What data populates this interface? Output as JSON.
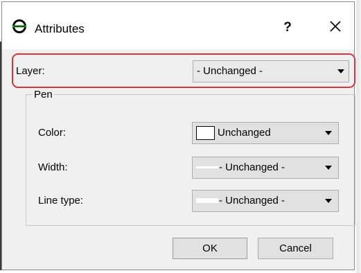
{
  "window": {
    "title": "Attributes",
    "help_label": "?",
    "icon": "attributes-app-icon",
    "close_icon": "close-icon"
  },
  "layer": {
    "label": "Layer:",
    "value": "- Unchanged -"
  },
  "pen": {
    "group_title": "Pen",
    "color": {
      "label": "Color:",
      "value": "Unchanged",
      "swatch_color": "#ffffff"
    },
    "width": {
      "label": "Width:",
      "value": "- Unchanged -"
    },
    "line_type": {
      "label": "Line type:",
      "value": "- Unchanged -"
    }
  },
  "buttons": {
    "ok": "OK",
    "cancel": "Cancel"
  },
  "colors": {
    "highlight": "#e0303c",
    "dialog_bg": "#f0f0f0",
    "control_bg": "#e1e1e1"
  }
}
